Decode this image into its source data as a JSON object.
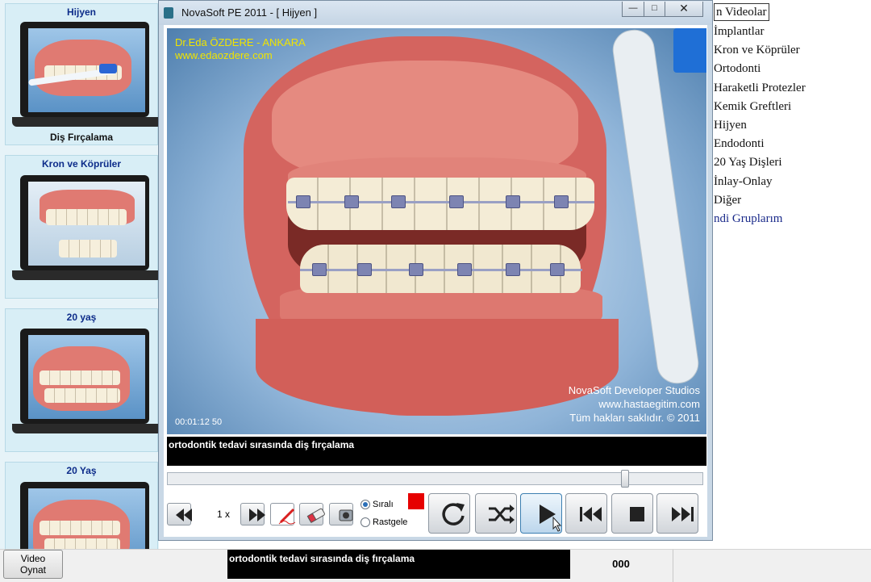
{
  "left_panel": {
    "cards": [
      {
        "title": "Hijyen",
        "caption": "Diş Fırçalama"
      },
      {
        "title": "Kron ve Köprüler",
        "caption": ""
      },
      {
        "title": "20 yaş",
        "caption": ""
      },
      {
        "title": "20 Yaş",
        "caption": ""
      }
    ]
  },
  "right_menu": {
    "items": [
      "n Videolar",
      "İmplantlar",
      "Kron ve Köprüler",
      "Ortodonti",
      "Haraketli Protezler",
      "Kemik Greftleri",
      "Hijyen",
      "Endodonti",
      "20 Yaş Dişleri",
      "İnlay-Onlay",
      "Diğer",
      "ndi Gruplarım"
    ]
  },
  "window": {
    "title": "NovaSoft PE 2011 - [ Hijyen ]",
    "controls": {
      "minimize": "—",
      "maximize": "□",
      "close": "✕"
    }
  },
  "video": {
    "watermark_top": {
      "name": "Dr.Eda ÖZDERE - ANKARA",
      "url": "www.edaozdere.com"
    },
    "watermark_bottom": {
      "studio": "NovaSoft Developer Studios",
      "url": "www.hastaegitim.com",
      "copyright": "Tüm hakları saklıdır. © 2011"
    },
    "timecode": "00:01:12 50"
  },
  "caption": "ortodontik tedavi sırasında diş fırçalama",
  "player_controls": {
    "playback_position": 0.86,
    "speed_label": "1 x",
    "order_options": [
      {
        "label": "Sıralı",
        "selected": true
      },
      {
        "label": "Rastgele",
        "selected": false
      }
    ],
    "pen_color": "#e60000",
    "icons": [
      "rewind-icon",
      "fast-forward-icon",
      "pen-icon",
      "eraser-icon",
      "camera-icon",
      "repeat-icon",
      "shuffle-icon",
      "play-icon",
      "previous-icon",
      "stop-icon",
      "next-icon"
    ]
  },
  "bottom_bar": {
    "button_label": "Video Oynat",
    "caption": "ortodontik tedavi sırasında diş fırçalama",
    "counter": "000"
  }
}
